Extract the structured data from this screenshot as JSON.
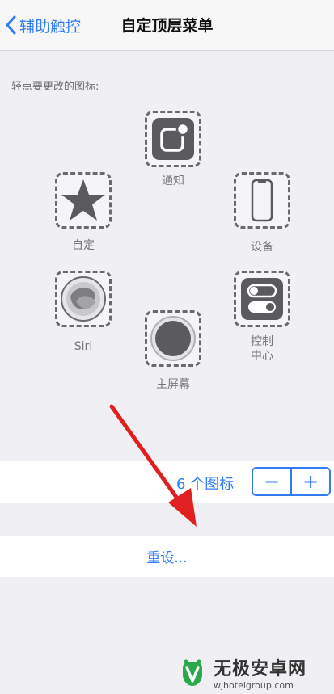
{
  "nav": {
    "back_label": "辅助触控",
    "title": "自定顶层菜单"
  },
  "hint": "轻点要更改的图标:",
  "icons": [
    {
      "label": "通知",
      "icon": "notification-icon"
    },
    {
      "label": "设备",
      "icon": "device-icon"
    },
    {
      "label": "自定",
      "icon": "star-icon"
    },
    {
      "label": "Siri",
      "icon": "siri-icon"
    },
    {
      "label": "主屏幕",
      "icon": "home-button-icon"
    },
    {
      "label": "控制\n中心",
      "icon": "control-center-icon"
    }
  ],
  "count": {
    "label": "6 个图标",
    "minus": "−",
    "plus": "+"
  },
  "reset_label": "重设...",
  "watermark": {
    "title": "无极安卓网",
    "url": "wjhotelgroup.com"
  },
  "colors": {
    "accent": "#2f7cf6",
    "arrow": "#e02020",
    "icon_fill": "#5b5b5f"
  }
}
